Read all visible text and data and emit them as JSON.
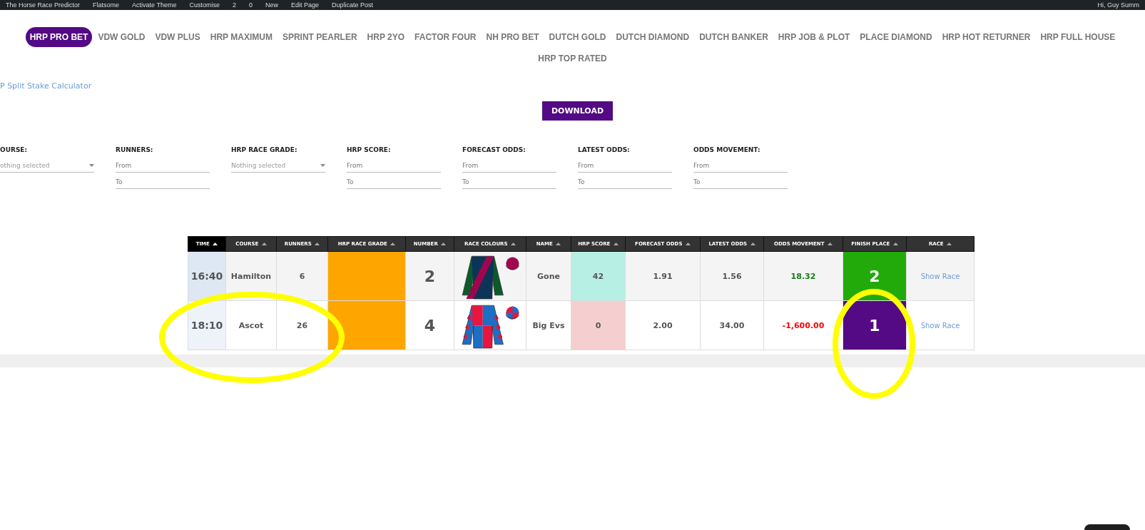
{
  "admin_bar": {
    "items": [
      "The Horse Race Predictor",
      "Flatsome",
      "Activate Theme",
      "Customise",
      "2",
      "0",
      "New",
      "Edit Page",
      "Duplicate Post"
    ],
    "greeting": "Hi, Guy Summ"
  },
  "nav": {
    "items": [
      {
        "label": "HRP PRO BET",
        "selected": true
      },
      {
        "label": "VDW GOLD",
        "selected": false
      },
      {
        "label": "VDW PLUS",
        "selected": false
      },
      {
        "label": "HRP MAXIMUM",
        "selected": false
      },
      {
        "label": "SPRINT PEARLER",
        "selected": false
      },
      {
        "label": "HRP 2YO",
        "selected": false
      },
      {
        "label": "FACTOR FOUR",
        "selected": false
      },
      {
        "label": "NH PRO BET",
        "selected": false
      },
      {
        "label": "DUTCH GOLD",
        "selected": false
      },
      {
        "label": "DUTCH DIAMOND",
        "selected": false
      },
      {
        "label": "DUTCH BANKER",
        "selected": false
      },
      {
        "label": "HRP JOB & PLOT",
        "selected": false
      },
      {
        "label": "PLACE DIAMOND",
        "selected": false
      },
      {
        "label": "HRP HOT RETURNER",
        "selected": false
      },
      {
        "label": "HRP FULL HOUSE",
        "selected": false
      },
      {
        "label": "HRP TOP RATED",
        "selected": false
      }
    ]
  },
  "calculator_link": "P Split Stake Calculator",
  "download_button": "DOWNLOAD",
  "filters": [
    {
      "kind": "select",
      "label": "OURSE:",
      "placeholder": "othing selected"
    },
    {
      "kind": "range",
      "label": "RUNNERS:",
      "fields": [
        {
          "placeholder": "From"
        },
        {
          "placeholder": "To"
        }
      ]
    },
    {
      "kind": "select",
      "label": "HRP RACE GRADE:",
      "placeholder": "Nothing selected"
    },
    {
      "kind": "range",
      "label": "HRP SCORE:",
      "fields": [
        {
          "placeholder": "From"
        },
        {
          "placeholder": "To"
        }
      ]
    },
    {
      "kind": "range",
      "label": "FORECAST ODDS:",
      "fields": [
        {
          "placeholder": "From"
        },
        {
          "placeholder": "To"
        }
      ]
    },
    {
      "kind": "range",
      "label": "LATEST ODDS:",
      "fields": [
        {
          "placeholder": "From"
        },
        {
          "placeholder": "To"
        }
      ]
    },
    {
      "kind": "range",
      "label": "ODDS MOVEMENT:",
      "fields": [
        {
          "placeholder": "From"
        },
        {
          "placeholder": "To"
        }
      ]
    }
  ],
  "table": {
    "columns": [
      {
        "label": "TIME",
        "selected": true
      },
      {
        "label": "COURSE",
        "selected": false
      },
      {
        "label": "RUNNERS",
        "selected": false
      },
      {
        "label": "HRP RACE GRADE",
        "selected": false
      },
      {
        "label": "NUMBER",
        "selected": false
      },
      {
        "label": "RACE COLOURS",
        "selected": false
      },
      {
        "label": "NAME",
        "selected": false
      },
      {
        "label": "HRP SCORE",
        "selected": false
      },
      {
        "label": "FORECAST ODDS",
        "selected": false
      },
      {
        "label": "LATEST ODDS",
        "selected": false
      },
      {
        "label": "ODDS MOVEMENT",
        "selected": false
      },
      {
        "label": "FINISH PLACE",
        "selected": false
      },
      {
        "label": "RACE",
        "selected": false
      }
    ],
    "rows": [
      {
        "time": "16:40",
        "course": "Hamilton",
        "runners": "6",
        "grade": {
          "color": "#ffa500"
        },
        "number": "2",
        "silks": {
          "kind": "sash",
          "parts": [
            {
              "kind": "body",
              "color": "#0c3358"
            },
            {
              "kind": "trim",
              "color": "#a0064e"
            },
            {
              "kind": "sleeves",
              "color": "#0b5a2a"
            },
            {
              "kind": "cap",
              "color": "#a0064e"
            }
          ]
        },
        "name": "Gone",
        "score": {
          "text": "42",
          "color": "#b8efe5"
        },
        "forecast_odds": "1.91",
        "latest_odds": "1.56",
        "odds_movement": {
          "text": "18.32",
          "color": "#1a7a1a"
        },
        "finish_place": {
          "text": "2",
          "color": "#22aa0a"
        },
        "race_link": "Show Race"
      },
      {
        "time": "18:10",
        "course": "Ascot",
        "runners": "26",
        "grade": {
          "color": "#ffa500"
        },
        "number": "4",
        "silks": {
          "kind": "quartered",
          "parts": [
            {
              "kind": "body",
              "color": "#e8163f"
            },
            {
              "kind": "trim",
              "color": "#1b6fc4"
            },
            {
              "kind": "sleeves",
              "color": "#1b6fc4"
            },
            {
              "kind": "cap",
              "color": "#e8163f"
            }
          ]
        },
        "name": "Big Evs",
        "score": {
          "text": "0",
          "color": "#f5cfcf"
        },
        "forecast_odds": "2.00",
        "latest_odds": "34.00",
        "odds_movement": {
          "text": "-1,600.00",
          "color": "#ff0000"
        },
        "finish_place": {
          "text": "1",
          "color": "#540a84"
        },
        "race_link": "Show Race"
      }
    ]
  },
  "scribbles": [
    {
      "kind": "ring"
    },
    {
      "kind": "ring"
    }
  ]
}
